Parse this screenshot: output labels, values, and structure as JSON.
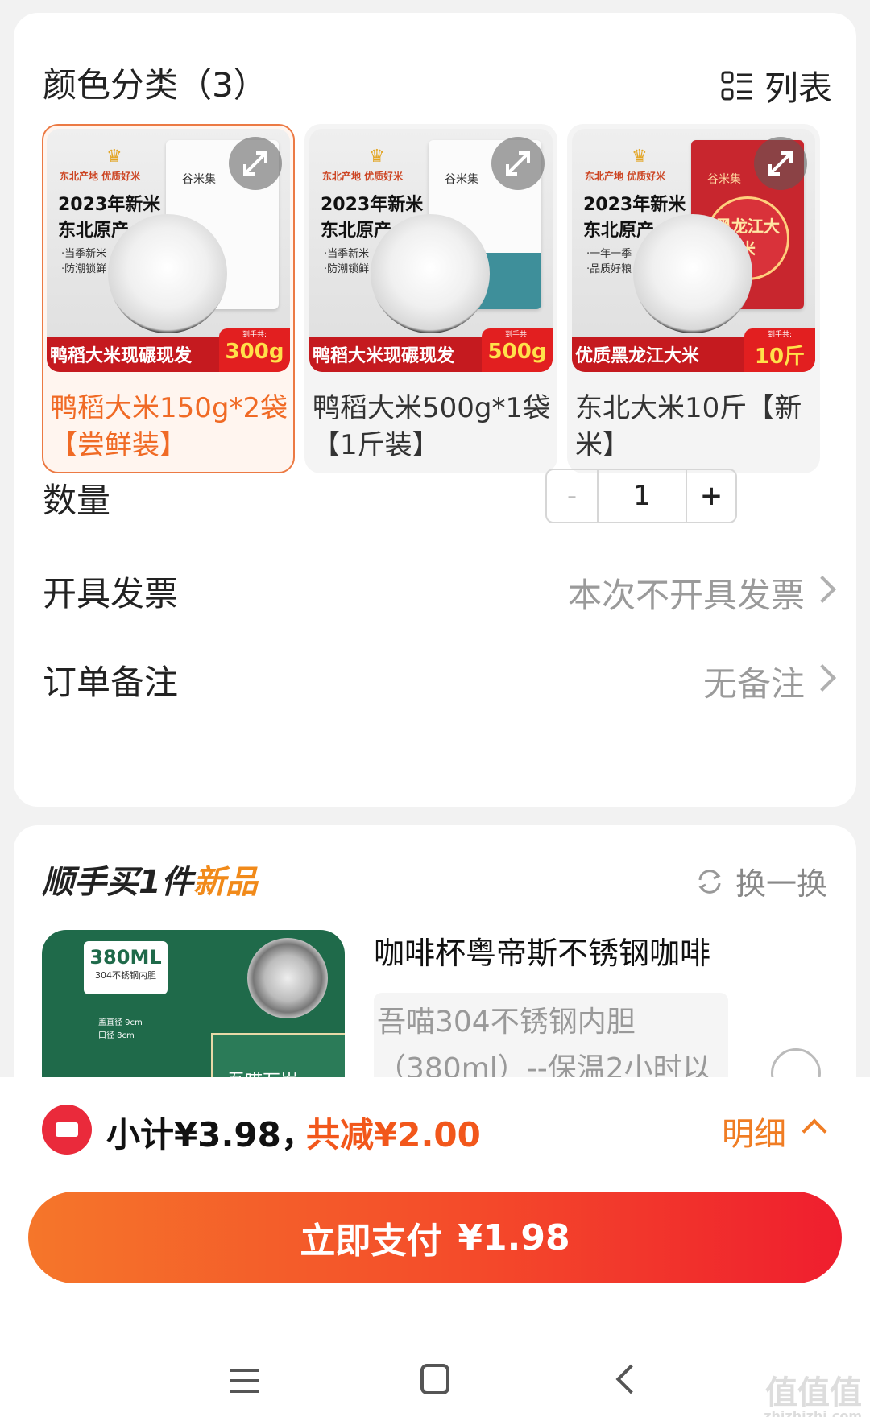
{
  "sku": {
    "section_title": "颜色分类（3）",
    "view_toggle_label": "列表",
    "variants": [
      {
        "label": "鸭稻大米150g*2袋【尝鲜装】",
        "selected": true,
        "image": {
          "tag": "东北产地 优质好米",
          "headline1": "2023年新米",
          "headline2": "东北原产",
          "bullets": "·当季新米\n·防潮锁鲜",
          "brand": "谷米集",
          "banner": "鸭稻大米现碾现发",
          "size_caption": "到手共:",
          "size": "300g"
        }
      },
      {
        "label": "鸭稻大米500g*1袋【1斤装】",
        "selected": false,
        "image": {
          "tag": "东北产地 优质好米",
          "headline1": "2023年新米",
          "headline2": "东北原产",
          "bullets": "·当季新米\n·防潮锁鲜",
          "brand": "谷米集",
          "banner": "鸭稻大米现碾现发",
          "size_caption": "到手共:",
          "size": "500g"
        }
      },
      {
        "label": "东北大米10斤【新米】",
        "selected": false,
        "image": {
          "tag": "东北产地 优质好米",
          "headline1": "2023年新米",
          "headline2": "东北原产",
          "bullets": "·一年一季\n·品质好粮",
          "brand": "谷米集",
          "seal": "黑龙江大米",
          "banner": "优质黑龙江大米",
          "size_caption": "到手共:",
          "size": "10斤"
        }
      }
    ]
  },
  "quantity": {
    "label": "数量",
    "minus": "-",
    "value": "1",
    "plus": "+"
  },
  "invoice": {
    "label": "开具发票",
    "value": "本次不开具发票"
  },
  "remark": {
    "label": "订单备注",
    "value": "无备注"
  },
  "addon": {
    "title_main": "顺手买1件",
    "title_highlight": "新品",
    "swap_label": "换一换",
    "product_name": "咖啡杯粤帝斯不锈钢咖啡",
    "product_desc": "吾喵304不锈钢内胆（380ml）--保温2小时以",
    "image": {
      "capacity": "380ML",
      "capacity_sub": "304不锈钢内胆",
      "dim1": "盖直径 9cm",
      "dim2": "口径 8cm",
      "box_text": "吾喵万岁"
    }
  },
  "footer": {
    "subtotal": "小计¥3.98，",
    "discount": "共减¥2.00",
    "details_label": "明细",
    "pay_label": "立即支付",
    "pay_amount": "¥1.98"
  },
  "watermark": {
    "main": "值值值",
    "sub": "zhizhizhi.com"
  },
  "colors": {
    "accent": "#f2571b",
    "selected_border": "#ec7a44",
    "pay_gradient_start": "#f5762a",
    "pay_gradient_end": "#ef1e2e"
  }
}
